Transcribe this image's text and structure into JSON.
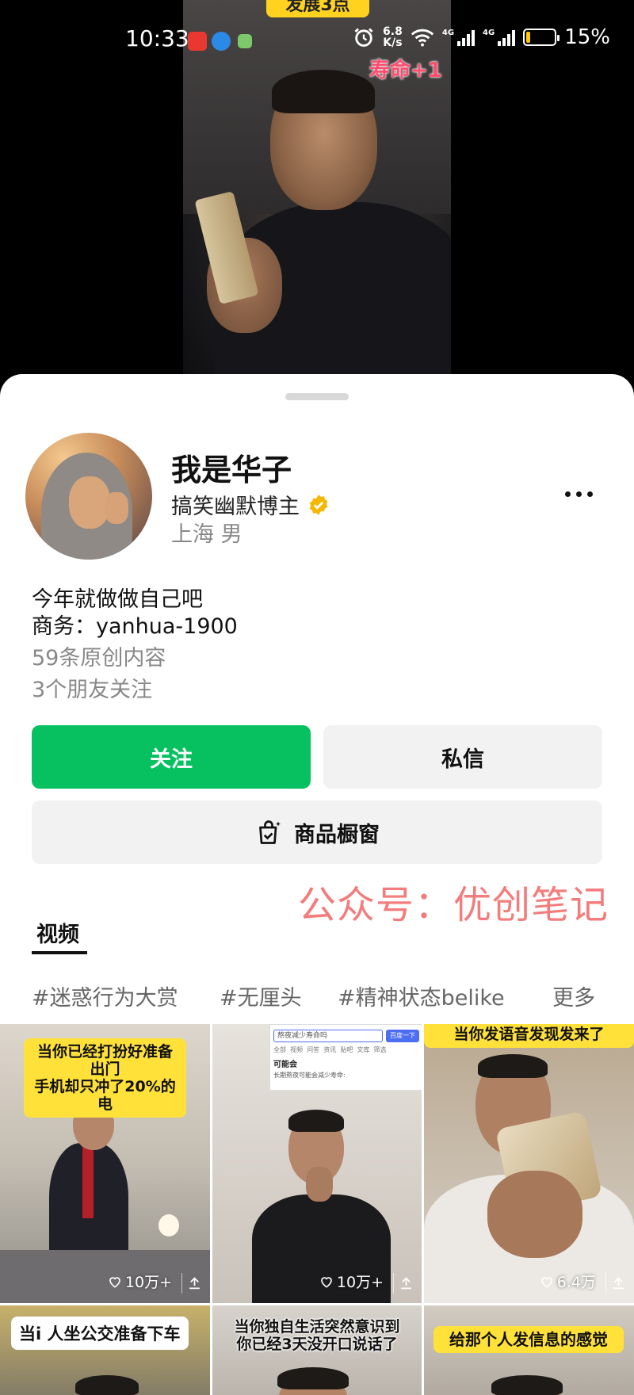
{
  "status_bar": {
    "time": "10:33",
    "net_speed_value": "6.8",
    "net_speed_unit": "K/s",
    "signal1_label": "4G",
    "signal2_label": "4G",
    "battery": "15%"
  },
  "video": {
    "top_badge": "发展3点",
    "caption": "寿命+1"
  },
  "profile": {
    "name": "我是华子",
    "role": "搞笑幽默博主",
    "location": "上海 男",
    "bio_line1": "今年就做做自己吧",
    "bio_line2": "商务：yanhua-1900",
    "original_count": "59条原创内容",
    "friends_follow": "3个朋友关注"
  },
  "buttons": {
    "follow": "关注",
    "message": "私信",
    "shop": "商品橱窗"
  },
  "watermark": "公众号：优创笔记",
  "tabs": {
    "videos": "视频"
  },
  "tags": [
    "#迷惑行为大赏",
    "#无厘头",
    "#精神状态belike",
    "更多"
  ],
  "videos": [
    {
      "caption": "当你已经打扮好准备出门\n手机却只冲了20%的电",
      "likes": "10万+"
    },
    {
      "search_query": "熬夜减少寿命吗",
      "search_button": "百度一下",
      "search_tabs": "全部  视频  问答  资讯  贴吧  文库  筛选",
      "search_answer": "可能会",
      "search_detail": "长期熬夜可能会减少寿命:",
      "likes": "10万+"
    },
    {
      "caption": "当你发语音发现发来了",
      "likes": "6.4万"
    },
    {
      "caption": "当i 人坐公交准备下车"
    },
    {
      "caption": "当你独自生活突然意识到\n你已经3天没开口说话了"
    },
    {
      "caption": "给那个人发信息的感觉"
    }
  ],
  "colors": {
    "follow_green": "#07c160",
    "watermark_red": "#f37d7d",
    "verify_gold": "#f5b800"
  }
}
